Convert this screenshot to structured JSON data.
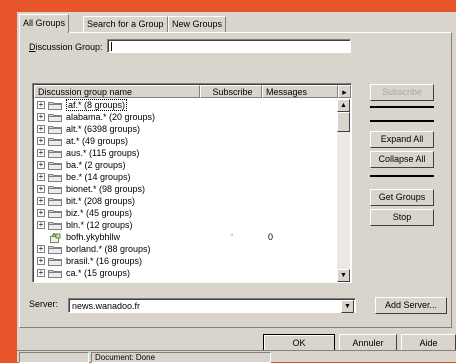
{
  "tabs": [
    {
      "label": "All Groups"
    },
    {
      "label": "Search for a Group"
    },
    {
      "label": "New Groups"
    }
  ],
  "discussion_group": {
    "label_key": "D",
    "label_rest": "iscussion Group:",
    "value": ""
  },
  "list": {
    "columns": [
      "Discussion group name",
      "Subscribe",
      "Messages"
    ],
    "rows": [
      {
        "name": "af.* (8 groups)",
        "subscribe": "",
        "messages": "",
        "selected": true
      },
      {
        "name": "alabama.* (20 groups)",
        "subscribe": "",
        "messages": ""
      },
      {
        "name": "alt.* (6398 groups)",
        "subscribe": "",
        "messages": ""
      },
      {
        "name": "at.* (49 groups)",
        "subscribe": "",
        "messages": ""
      },
      {
        "name": "aus.* (115 groups)",
        "subscribe": "",
        "messages": ""
      },
      {
        "name": "ba.* (2 groups)",
        "subscribe": "",
        "messages": ""
      },
      {
        "name": "be.* (14 groups)",
        "subscribe": "",
        "messages": ""
      },
      {
        "name": "bionet.* (98 groups)",
        "subscribe": "",
        "messages": ""
      },
      {
        "name": "bit.* (208 groups)",
        "subscribe": "",
        "messages": ""
      },
      {
        "name": "biz.* (45 groups)",
        "subscribe": "",
        "messages": ""
      },
      {
        "name": "bln.* (12 groups)",
        "subscribe": "",
        "messages": ""
      },
      {
        "name": "bofh.ykybhllw",
        "subscribe": "°",
        "messages": "0",
        "leaf": true
      },
      {
        "name": "borland.* (88 groups)",
        "subscribe": "",
        "messages": ""
      },
      {
        "name": "brasil.* (16 groups)",
        "subscribe": "",
        "messages": ""
      },
      {
        "name": "ca.* (15 groups)",
        "subscribe": "",
        "messages": ""
      }
    ]
  },
  "buttons": {
    "subscribe": "Subscribe",
    "expand_all": "Expand All",
    "collapse_all": "Collapse All",
    "get_groups": "Get Groups",
    "stop": "Stop",
    "add_server": "Add Server...",
    "ok": "OK",
    "cancel": "Annuler",
    "help": "Aide"
  },
  "server": {
    "label": "Server:",
    "value": "news.wanadoo.fr"
  },
  "status": {
    "text": "Document: Done"
  }
}
